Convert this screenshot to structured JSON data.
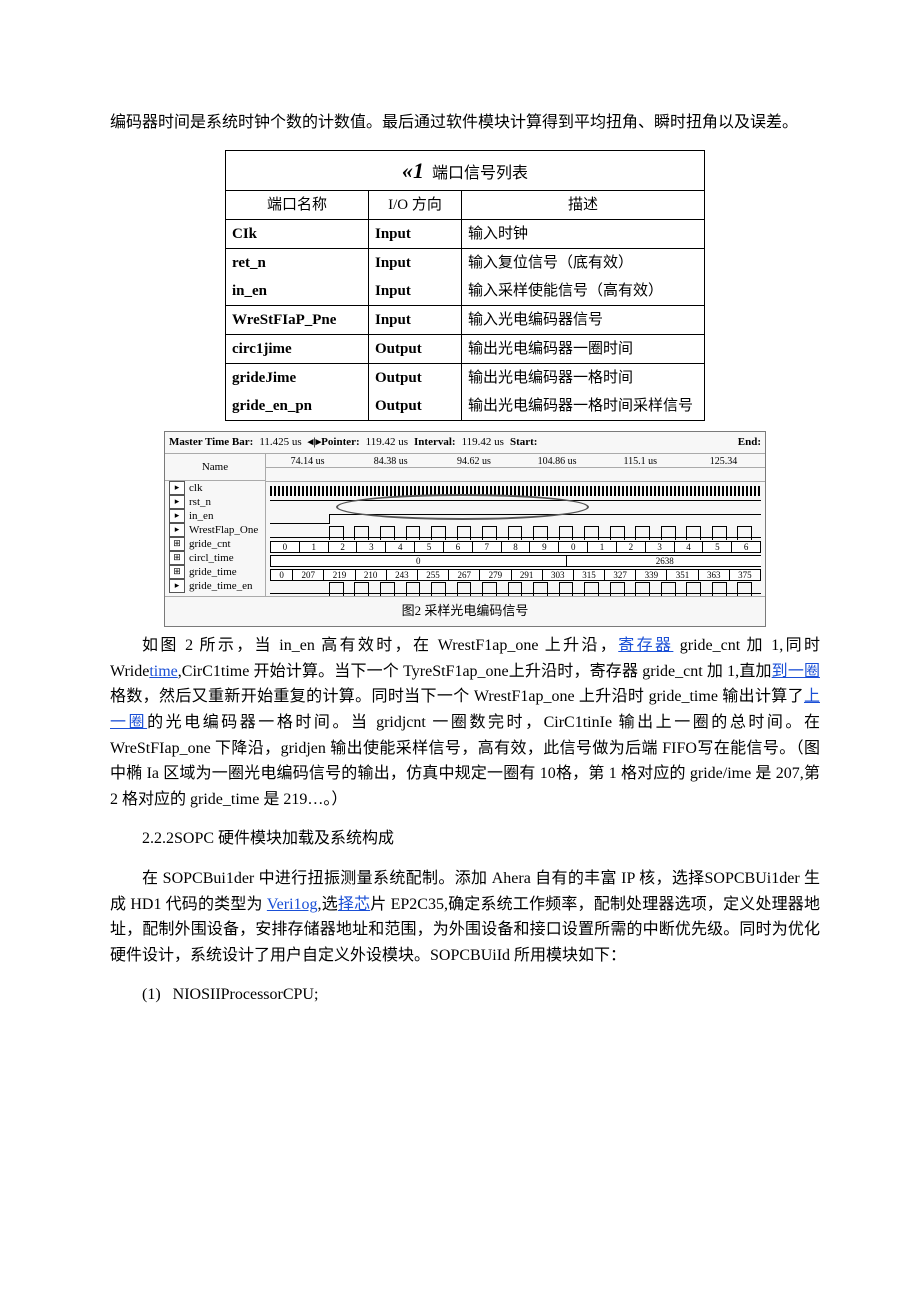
{
  "intro": "编码器时间是系统时钟个数的计数值。最后通过软件模块计算得到平均扭角、瞬时扭角以及误差。",
  "table": {
    "title_prefix": "«1",
    "title": "端口信号列表",
    "headers": {
      "name": "端口名称",
      "dir": "I/O 方向",
      "desc": "描述"
    },
    "rows": [
      {
        "name": "CIk",
        "dir": "Input",
        "desc": "输入时钟"
      },
      {
        "name": "ret_n",
        "dir": "Input",
        "desc": "输入复位信号（底有效）"
      },
      {
        "name": "in_en",
        "dir": "Input",
        "desc": "输入采样使能信号（高有效）"
      },
      {
        "name": "WreStFIaP_Pne",
        "dir": "Input",
        "desc": "输入光电编码器信号"
      },
      {
        "name": "circ1jime",
        "dir": "Output",
        "desc": "输出光电编码器一圈时间"
      },
      {
        "name": "grideJime",
        "dir": "Output",
        "desc": "输出光电编码器一格时间"
      },
      {
        "name": "gride_en_pn",
        "dir": "Output",
        "desc": "输出光电编码器一格时间采样信号"
      }
    ]
  },
  "figure": {
    "topbar": {
      "master_lbl": "Master Time Bar:",
      "master_val": "11.425 us",
      "pointer_lbl": "Pointer:",
      "pointer_val": "119.42 us",
      "interval_lbl": "Interval:",
      "interval_val": "119.42 us",
      "start_lbl": "Start:",
      "end_lbl": "End:"
    },
    "name_header": "Name",
    "time_ticks": [
      "74.14 us",
      "84.38 us",
      "94.62 us",
      "104.86 us",
      "115.1 us",
      "125.34"
    ],
    "signals": [
      "clk",
      "rst_n",
      "in_en",
      "WrestFlap_One",
      "gride_cnt",
      "circl_time",
      "gride_time",
      "gride_time_en"
    ],
    "gride_cnt_vals": [
      "0",
      "1",
      "2",
      "3",
      "4",
      "5",
      "6",
      "7",
      "8",
      "9",
      "0",
      "1",
      "2",
      "3",
      "4",
      "5",
      "6"
    ],
    "circl_time_vals": [
      "0",
      "2638"
    ],
    "gride_time_vals": [
      "0",
      "207",
      "219",
      "210",
      "243",
      "255",
      "267",
      "279",
      "291",
      "303",
      "315",
      "327",
      "339",
      "351",
      "363",
      "375"
    ],
    "caption": "图2 采样光电编码信号"
  },
  "para2_part1": "如图 2 所示，当 in_en 高有效时，在 WrestF1ap_one 上升沿，",
  "para2_link1": "寄存器",
  "para2_part2": "gride_cnt 加 1,同时 Wride",
  "para2_link2": "time",
  "para2_part3": ",CirC1time 开始计算。当下一个 TyreStF1ap_one上升沿时，寄存器 gride_cnt 加 1,直加",
  "para2_link3": "到一圈",
  "para2_part4": "格数，然后又重新开始重复的计算。同时当下一个 WrestF1ap_one 上升沿时 gride_time 输出计算了",
  "para2_link4": "上一圈",
  "para2_part5": "的光电编码器一格时间。当 gridjcnt 一圈数完时，CirC1tinIe 输出上一圈的总时间。在WreStFIap_one 下降沿，gridjen 输出使能采样信号，高有效，此信号做为后端 FIFO写在能信号。（图中椭 Ia 区域为一圈光电编码信号的输出，仿真中规定一圈有 10格，第 1 格对应的 gride/ime 是 207,第 2 格对应的 gride_time 是 219…。）",
  "heading1": "2.2.2SOPC 硬件模块加载及系统构成",
  "para3_part1": "在 SOPCBui1der 中进行扭振测量系统配制。添加 Ahera 自有的丰富 IP 核，选择SOPCBUi1der 生成 HD1 代码的类型为 ",
  "para3_link1": "Veri1og",
  "para3_part2": ",选",
  "para3_link2": "择芯",
  "para3_part3": "片 EP2C35,确定系统工作频率，配制处理器选项，定义处理器地址，配制外围设备，安排存储器地址和范围，为外围设备和接口设置所需的中断优先级。同时为优化硬件设计，系统设计了用户自定义外设模块。SOPCBUiId 所用模块如下：",
  "list_item1_num": "(1)",
  "list_item1_txt": "NIOSIIProcessorCPU;"
}
